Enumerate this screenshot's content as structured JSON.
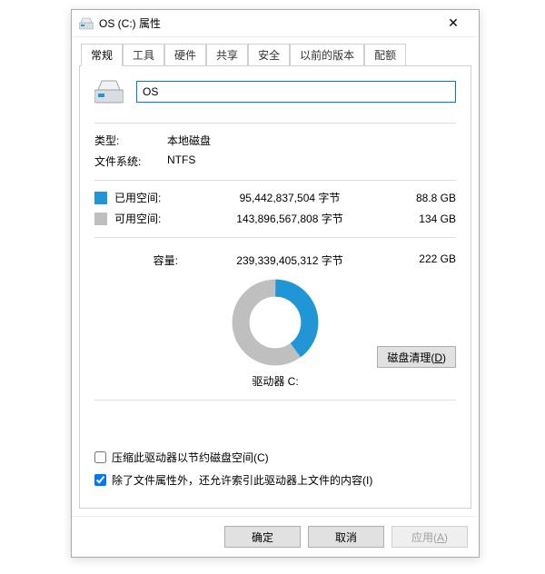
{
  "window": {
    "title": "OS (C:) 属性",
    "close_glyph": "✕"
  },
  "tabs": {
    "t0": "常规",
    "t1": "工具",
    "t2": "硬件",
    "t3": "共享",
    "t4": "安全",
    "t5": "以前的版本",
    "t6": "配额"
  },
  "drive": {
    "name_value": "OS",
    "type_label": "类型:",
    "type_value": "本地磁盘",
    "fs_label": "文件系统:",
    "fs_value": "NTFS",
    "used_label": "已用空间:",
    "used_bytes": "95,442,837,504 字节",
    "used_gb": "88.8 GB",
    "free_label": "可用空间:",
    "free_bytes": "143,896,567,808 字节",
    "free_gb": "134 GB",
    "capacity_label": "容量:",
    "capacity_bytes": "239,339,405,312 字节",
    "capacity_gb": "222 GB",
    "drive_caption": "驱动器 C:",
    "cleanup_label": "磁盘清理(D)"
  },
  "checks": {
    "compress_label": "压缩此驱动器以节约磁盘空间(C)",
    "index_label": "除了文件属性外，还允许索引此驱动器上文件的内容(I)"
  },
  "buttons": {
    "ok": "确定",
    "cancel": "取消",
    "apply": "应用(A)"
  },
  "colors": {
    "used": "#2196d6",
    "free": "#bfbfbf"
  },
  "chart_data": {
    "type": "pie",
    "title": "驱动器 C:",
    "series": [
      {
        "name": "已用空间",
        "value": 95442837504,
        "fraction": 0.399,
        "color": "#2196d6"
      },
      {
        "name": "可用空间",
        "value": 143896567808,
        "fraction": 0.601,
        "color": "#bfbfbf"
      }
    ],
    "total": 239339405312,
    "donut_inner_ratio": 0.55
  }
}
